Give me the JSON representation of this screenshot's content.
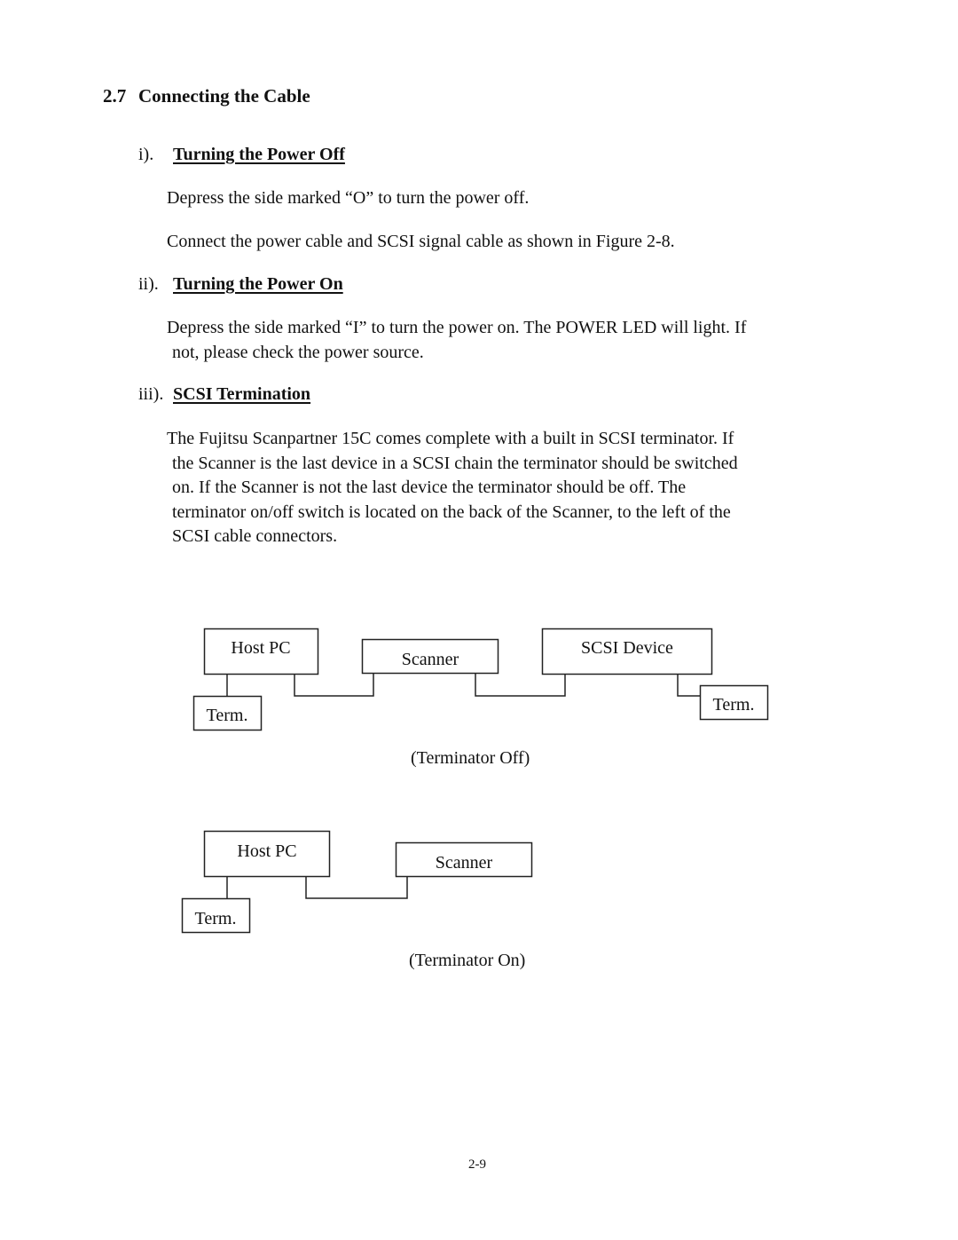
{
  "section": {
    "number": "2.7",
    "title": "Connecting the Cable"
  },
  "subsections": [
    {
      "marker": "i).",
      "title": "Turning the Power Off",
      "paragraphs": [
        [
          "Depress the side marked “O” to turn the power off."
        ],
        [
          "Connect the power cable and SCSI signal cable as shown in Figure 2-8."
        ]
      ]
    },
    {
      "marker": "ii).",
      "title": "Turning the Power On",
      "paragraphs": [
        [
          "Depress the side marked “I” to turn the power on.  The POWER LED will light.  If",
          "not, please check the power source."
        ]
      ]
    },
    {
      "marker": "iii).",
      "title": "SCSI Termination",
      "paragraphs": [
        [
          "The Fujitsu Scanpartner 15C comes complete with a built in SCSI terminator.  If",
          "the Scanner is the last device in a SCSI chain the terminator should be switched",
          "on.  If the Scanner is not the last device the terminator should be off.  The",
          "terminator on/off switch is located on the back of the Scanner, to the left of the",
          "SCSI cable connectors."
        ]
      ]
    }
  ],
  "figures": [
    {
      "caption": "(Terminator Off)",
      "boxes": {
        "host_pc": "Host PC",
        "host_term": "Term.",
        "scanner": "Scanner",
        "scsi_device": "SCSI Device",
        "device_term": "Term."
      }
    },
    {
      "caption": "(Terminator On)",
      "boxes": {
        "host_pc": "Host PC",
        "host_term": "Term.",
        "scanner": "Scanner"
      }
    }
  ],
  "footer": {
    "page_number": "2-9"
  }
}
